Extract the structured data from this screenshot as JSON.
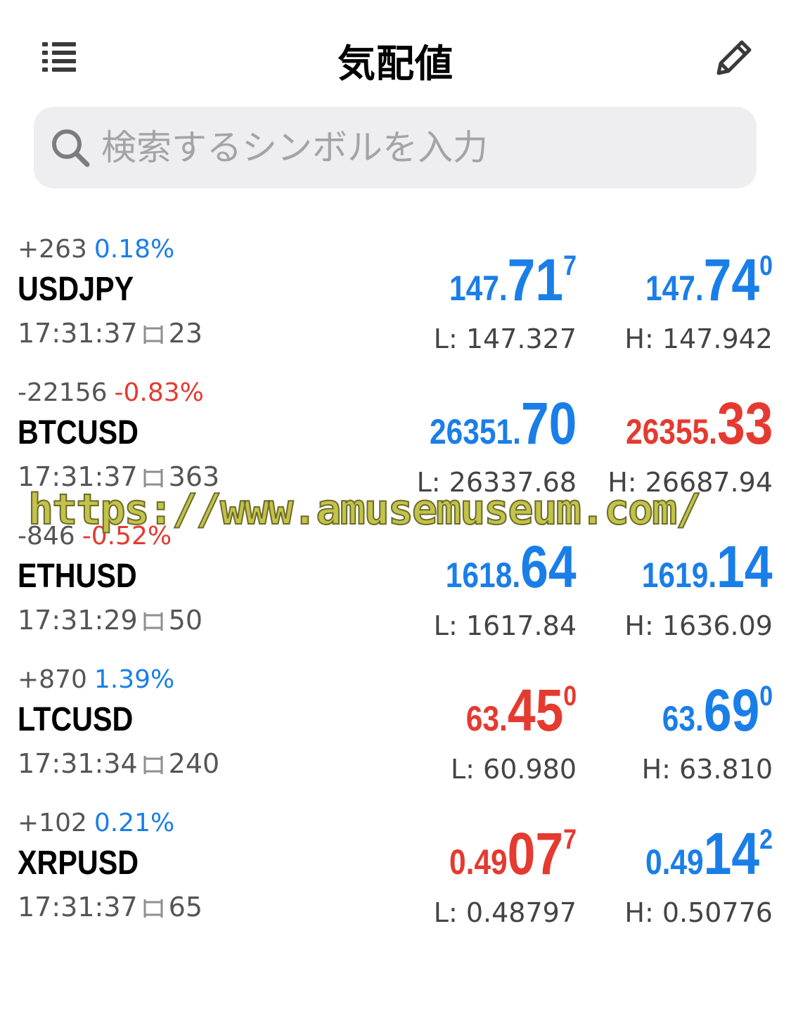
{
  "header": {
    "title": "気配値",
    "menu_icon": "list-icon",
    "edit_icon": "pencil-icon"
  },
  "search": {
    "placeholder": "検索するシンボルを入力",
    "value": "",
    "icon": "search-icon"
  },
  "colors": {
    "up": "#1a7ee8",
    "down": "#e53a30",
    "secondary_text": "#555555",
    "search_bg": "#eeeef0"
  },
  "quotes": [
    {
      "change_points": "+263",
      "change_percent": "0.18%",
      "change_dir": "up",
      "symbol": "USDJPY",
      "time": "17:31:37",
      "spread": "23",
      "bid": {
        "small": "147.",
        "big": "71",
        "sup": "7",
        "dir": "up"
      },
      "ask": {
        "small": "147.",
        "big": "74",
        "sup": "0",
        "dir": "up"
      },
      "low": "L: 147.327",
      "high": "H: 147.942"
    },
    {
      "change_points": "-22156",
      "change_percent": "-0.83%",
      "change_dir": "down",
      "symbol": "BTCUSD",
      "time": "17:31:37",
      "spread": "363",
      "bid": {
        "small": "26351.",
        "big": "70",
        "sup": "",
        "dir": "up"
      },
      "ask": {
        "small": "26355.",
        "big": "33",
        "sup": "",
        "dir": "down"
      },
      "low": "L: 26337.68",
      "high": "H: 26687.94"
    },
    {
      "change_points": "-846",
      "change_percent": "-0.52%",
      "change_dir": "down",
      "symbol": "ETHUSD",
      "time": "17:31:29",
      "spread": "50",
      "bid": {
        "small": "1618.",
        "big": "64",
        "sup": "",
        "dir": "up"
      },
      "ask": {
        "small": "1619.",
        "big": "14",
        "sup": "",
        "dir": "up"
      },
      "low": "L: 1617.84",
      "high": "H: 1636.09"
    },
    {
      "change_points": "+870",
      "change_percent": "1.39%",
      "change_dir": "up",
      "symbol": "LTCUSD",
      "time": "17:31:34",
      "spread": "240",
      "bid": {
        "small": "63.",
        "big": "45",
        "sup": "0",
        "dir": "down"
      },
      "ask": {
        "small": "63.",
        "big": "69",
        "sup": "0",
        "dir": "up"
      },
      "low": "L: 60.980",
      "high": "H: 63.810"
    },
    {
      "change_points": "+102",
      "change_percent": "0.21%",
      "change_dir": "up",
      "symbol": "XRPUSD",
      "time": "17:31:37",
      "spread": "65",
      "bid": {
        "small": "0.49",
        "big": "07",
        "sup": "7",
        "dir": "down"
      },
      "ask": {
        "small": "0.49",
        "big": "14",
        "sup": "2",
        "dir": "up"
      },
      "low": "L: 0.48797",
      "high": "H: 0.50776"
    }
  ],
  "watermark": "https://www.amusemuseum.com/"
}
